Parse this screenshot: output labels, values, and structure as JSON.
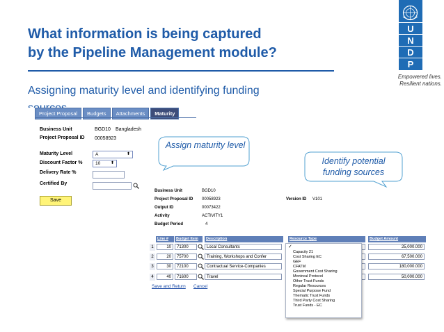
{
  "slide": {
    "title_line1": "What information is being captured",
    "title_line2": "by the Pipeline Management module?",
    "subtitle_line1": "Assigning maturity level and identifying funding",
    "subtitle_line2": "sources",
    "brand": {
      "letters": [
        "U",
        "N",
        "D",
        "P"
      ],
      "tagline1": "Empowered lives.",
      "tagline2": "Resilient nations.",
      "color": "#1f6cb5"
    },
    "title_color": "#1f5ba8"
  },
  "tabs": [
    "Project Proposal",
    "Budgets",
    "Attachments",
    "Maturity"
  ],
  "active_tab": "Maturity",
  "maturity_form": {
    "business_unit_label": "Business Unit",
    "business_unit": "BGD10",
    "business_unit_desc": "Bangladesh",
    "proposal_id_label": "Project Proposal ID",
    "proposal_id": "00058923",
    "maturity_level_label": "Maturity Level",
    "maturity_level": "A",
    "discount_label": "Discount Factor %",
    "discount": "10",
    "delivery_label": "Delivery Rate %",
    "delivery": "",
    "certified_label": "Certified By",
    "certified": "",
    "save_label": "Save"
  },
  "callouts": {
    "maturity": "Assign maturity level",
    "funding": "Identify potential funding sources"
  },
  "budget_header": {
    "business_unit_label": "Business Unit",
    "business_unit": "BGD10",
    "proposal_id_label": "Project Proposal ID",
    "proposal_id": "00058923",
    "output_id_label": "Output ID",
    "output_id": "00073422",
    "activity_label": "Activity",
    "activity": "ACTIVITY1",
    "budget_period_label": "Budget Period",
    "budget_period": "4",
    "version_label": "Version ID",
    "version": "V101"
  },
  "grid": {
    "columns": [
      "Line #",
      "Budget Item",
      "Description",
      "Resource Type",
      "Budget Amount"
    ],
    "rows": [
      {
        "num": "1",
        "line": "10",
        "item": "71300",
        "desc": "Local Consultants",
        "amount": "25,000.000"
      },
      {
        "num": "2",
        "line": "20",
        "item": "75700",
        "desc": "Training, Workshops and Confer",
        "amount": "67,500.000"
      },
      {
        "num": "3",
        "line": "30",
        "item": "72100",
        "desc": "Contractual Service-Companies",
        "amount": "180,000.000"
      },
      {
        "num": "4",
        "line": "40",
        "item": "71600",
        "desc": "Travel",
        "amount": "50,000.000"
      }
    ],
    "save_return": "Save and Return",
    "cancel": "Cancel"
  },
  "resource_menu": {
    "checkmark": "✓",
    "options": [
      "Capacity 21",
      "Cost Sharing EC",
      "GEF",
      "CFATM",
      "Government Cost Sharing",
      "Montreal Protocol",
      "Other Trust Funds",
      "Regular Resources",
      "Special Purpose Fund",
      "Thematic Trust Funds",
      "Third Party Cost Sharing",
      "Trust Funds - EC"
    ]
  }
}
